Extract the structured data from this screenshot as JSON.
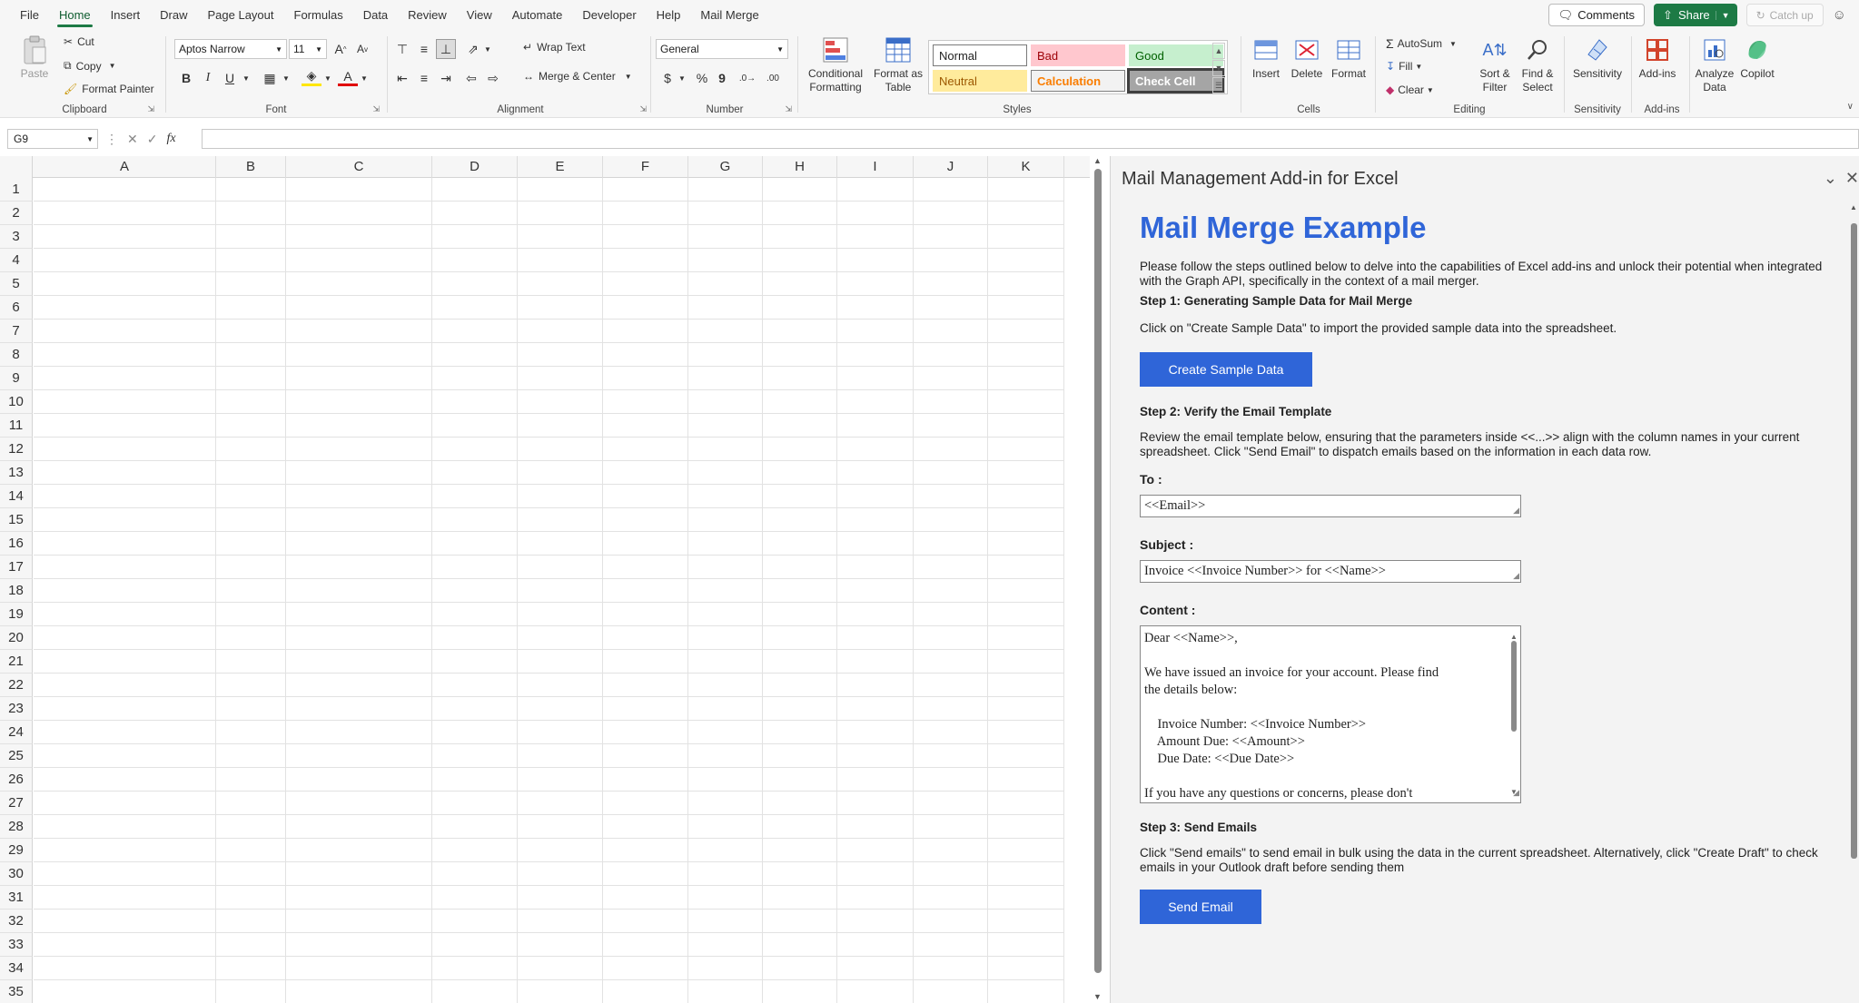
{
  "menu": {
    "tabs": [
      "File",
      "Home",
      "Insert",
      "Draw",
      "Page Layout",
      "Formulas",
      "Data",
      "Review",
      "View",
      "Automate",
      "Developer",
      "Help",
      "Mail Merge"
    ],
    "active": "Home",
    "comments_label": "Comments",
    "share_label": "Share",
    "catchup_label": "Catch up"
  },
  "ribbon": {
    "clipboard": {
      "label": "Clipboard",
      "paste": "Paste",
      "cut": "Cut",
      "copy": "Copy",
      "format_painter": "Format Painter"
    },
    "font": {
      "label": "Font",
      "font_name": "Aptos Narrow",
      "font_size": "11",
      "bold": "B",
      "italic": "I",
      "underline": "U"
    },
    "alignment": {
      "label": "Alignment",
      "wrap_text": "Wrap Text",
      "merge_center": "Merge & Center"
    },
    "number": {
      "label": "Number",
      "format": "General",
      "currency": "$",
      "percent": "%",
      "comma": "9"
    },
    "styles": {
      "label": "Styles",
      "conditional_formatting": "Conditional Formatting",
      "format_as_table": "Format as Table",
      "cells": [
        {
          "name": "Normal",
          "bg": "#ffffff",
          "fg": "#222222",
          "border": "#7a7a7a"
        },
        {
          "name": "Bad",
          "bg": "#ffc7ce",
          "fg": "#9c0006",
          "border": "#ffc7ce"
        },
        {
          "name": "Good",
          "bg": "#c6efce",
          "fg": "#006100",
          "border": "#c6efce"
        },
        {
          "name": "Neutral",
          "bg": "#ffeb9c",
          "fg": "#9c5700",
          "border": "#ffeb9c"
        },
        {
          "name": "Calculation",
          "bg": "#f2f2f2",
          "fg": "#fa7d00",
          "border": "#7f7f7f"
        },
        {
          "name": "Check Cell",
          "bg": "#a5a5a5",
          "fg": "#ffffff",
          "border": "#3f3f3f"
        }
      ]
    },
    "cells": {
      "label": "Cells",
      "insert": "Insert",
      "delete": "Delete",
      "format": "Format"
    },
    "editing": {
      "label": "Editing",
      "autosum": "AutoSum",
      "fill": "Fill",
      "clear": "Clear",
      "sort_filter": "Sort & Filter",
      "find_select": "Find & Select"
    },
    "sensitivity": {
      "label": "Sensitivity",
      "button": "Sensitivity"
    },
    "addins": {
      "label": "Add-ins",
      "button": "Add-ins",
      "analyze_data": "Analyze Data",
      "copilot": "Copilot"
    }
  },
  "formula_bar": {
    "name_box": "G9",
    "fx": "fx",
    "value": ""
  },
  "grid": {
    "columns": [
      "A",
      "B",
      "C",
      "D",
      "E",
      "F",
      "G",
      "H",
      "I",
      "J",
      "K"
    ],
    "rows": [
      "1",
      "2",
      "3",
      "4",
      "5",
      "6",
      "7",
      "8",
      "9",
      "10",
      "11",
      "12",
      "13",
      "14",
      "15",
      "16",
      "17",
      "18",
      "19",
      "20",
      "21",
      "22",
      "23",
      "24",
      "25",
      "26",
      "27",
      "28",
      "29",
      "30",
      "31",
      "32",
      "33",
      "34",
      "35"
    ]
  },
  "pane": {
    "title": "Mail Management Add-in for Excel",
    "heading": "Mail Merge Example",
    "intro": "Please follow the steps outlined below to delve into the capabilities of Excel add-ins and unlock their potential when integrated with the Graph API, specifically in the context of a mail merger.",
    "step1_title": "Step 1: Generating Sample Data for Mail Merge",
    "step1_text": "Click on \"Create Sample Data\" to import the provided sample data into the spreadsheet.",
    "create_button": "Create Sample Data",
    "step2_title": "Step 2: Verify the Email Template",
    "step2_text": "Review the email template below, ensuring that the parameters inside <<...>> align with the column names in your current spreadsheet. Click \"Send Email\" to dispatch emails based on the information in each data row.",
    "to_label": "To :",
    "to_value": "<<Email>>",
    "subject_label": "Subject :",
    "subject_value": "Invoice <<Invoice Number>> for <<Name>>",
    "content_label": "Content :",
    "content_lines": [
      "Dear <<Name>>,",
      "",
      "We have issued an invoice for your account. Please find",
      "the details below:",
      "",
      "    Invoice Number: <<Invoice Number>>",
      "    Amount Due: <<Amount>>",
      "    Due Date: <<Due Date>>",
      "",
      "If you have any questions or concerns, please don't"
    ],
    "step3_title": "Step 3: Send Emails",
    "step3_text": "Click \"Send emails\" to send email in bulk using the data in the current spreadsheet. Alternatively, click \"Create Draft\" to check emails in your Outlook draft before sending them",
    "send_button": "Send Email"
  }
}
